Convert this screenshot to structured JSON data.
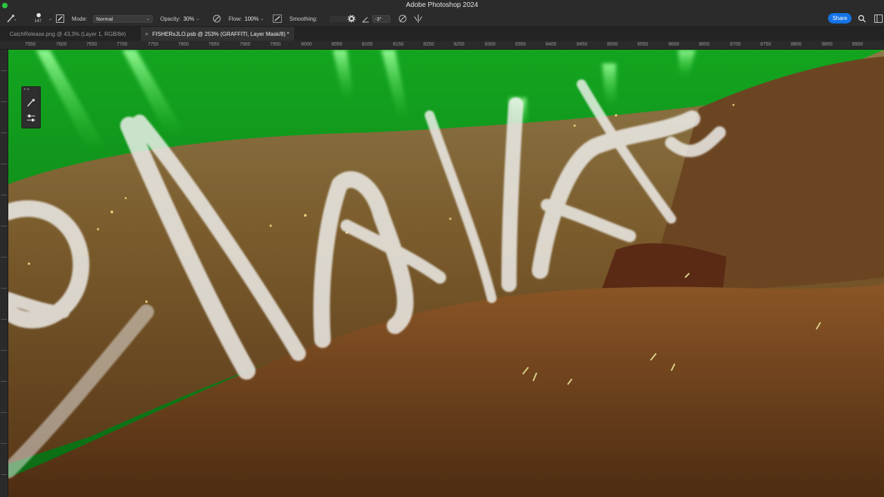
{
  "app": {
    "title": "Adobe Photoshop 2024"
  },
  "options_bar": {
    "brush_size": "147",
    "mode_label": "Mode:",
    "mode_value": "Normal",
    "opacity_label": "Opacity:",
    "opacity_value": "30%",
    "flow_label": "Flow:",
    "flow_value": "100%",
    "smoothing_label": "Smoothing:",
    "angle_value": "-3°",
    "share_label": "Share"
  },
  "tabs": [
    {
      "label": "CatchRelease.png @ 43,3% (Layer 1, RGB/8#)",
      "active": false
    },
    {
      "label": "FISHERxJLO.psb @ 253% (GRAFFITI, Layer Mask/8) *",
      "active": true
    }
  ],
  "ruler": {
    "ticks": [
      "7550",
      "7600",
      "7650",
      "7700",
      "7750",
      "7800",
      "7850",
      "7900",
      "7950",
      "8000",
      "8050",
      "8100",
      "8150",
      "8200",
      "8250",
      "8300",
      "8350",
      "8400",
      "8450",
      "8500",
      "8550",
      "8600",
      "8650",
      "8700",
      "8750",
      "8800",
      "8850",
      "8900"
    ]
  },
  "icons": {
    "brush_tool": "brush-icon",
    "brush_preset": "brush-preset-icon",
    "toggle_panel": "brush-settings-icon",
    "airbrush": "airbrush-icon",
    "flow_pressure": "pressure-icon",
    "gear": "gear-icon",
    "angle": "angle-icon",
    "pressure_size": "pressure-size-icon",
    "symmetry": "symmetry-icon",
    "search": "search-icon",
    "panel_brush": "brush-icon",
    "panel_sliders": "sliders-icon"
  },
  "colors": {
    "share_blue": "#1473e6",
    "background_green": "#0f9a1a",
    "fabric_brown": "#7a5a2c"
  }
}
